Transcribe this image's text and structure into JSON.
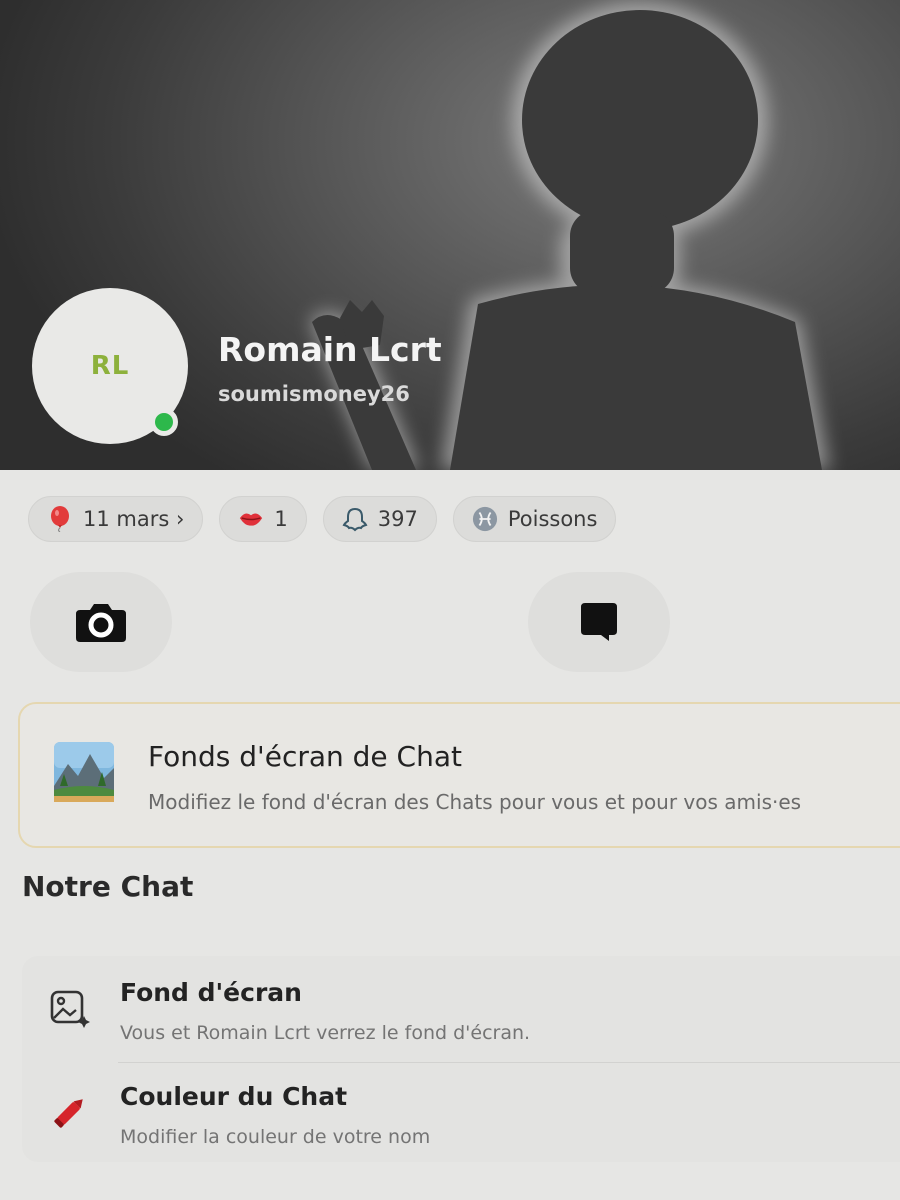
{
  "profile": {
    "initials": "RL",
    "display_name": "Romain Lcrt",
    "username": "soumismoney26",
    "status_color": "#2db84b",
    "initials_color": "#8db13c"
  },
  "chips": [
    {
      "icon": "balloon-icon",
      "label": "11 mars ›"
    },
    {
      "icon": "lips-icon",
      "label": "1"
    },
    {
      "icon": "ghost-icon",
      "label": "397"
    },
    {
      "icon": "zodiac-icon",
      "label": "Poissons"
    }
  ],
  "actions": {
    "camera_icon": "camera-icon",
    "chat_icon": "chat-bubble-icon"
  },
  "promo": {
    "title": "Fonds d'écran de Chat",
    "subtitle": "Modifiez le fond d'écran des Chats pour vous et pour vos amis·es",
    "accent": "#e5d7b0"
  },
  "section": {
    "title": "Notre Chat",
    "items": [
      {
        "icon": "wallpaper-image-icon",
        "title": "Fond d'écran",
        "subtitle": "Vous et Romain Lcrt verrez le fond d'écran."
      },
      {
        "icon": "crayon-icon",
        "title": "Couleur du Chat",
        "subtitle": "Modifier la couleur de votre nom"
      }
    ]
  }
}
